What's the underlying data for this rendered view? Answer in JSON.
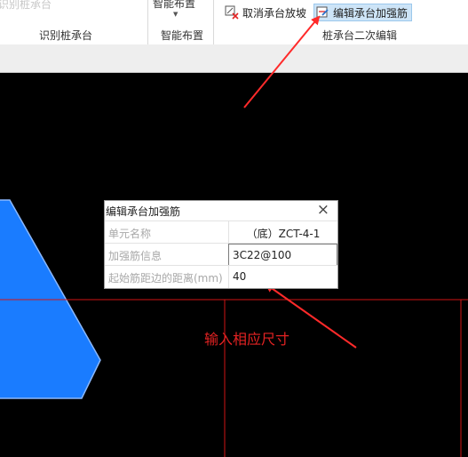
{
  "ribbon": {
    "faded_item": "识别桩承台",
    "groups": {
      "identify_label": "识别桩承台",
      "smart_top": "智能布置",
      "smart_label": "智能布置",
      "secondary_label": "桩承台二次编辑"
    },
    "buttons": {
      "cancel_slope": "取消承台放坡",
      "edit_rebar": "编辑承台加强筋"
    }
  },
  "dialog": {
    "title": "编辑承台加强筋",
    "rows": [
      {
        "label": "单元名称",
        "value": "（底）ZCT-4-1"
      },
      {
        "label": "加强筋信息",
        "value": "3C22@100"
      },
      {
        "label": "起始筋距边的距离(mm)",
        "value": "40"
      }
    ]
  },
  "annotation": {
    "text": "输入相应尺寸",
    "color": "#e22222"
  },
  "colors": {
    "canvas": "#000000",
    "shape_fill": "#1a7cff",
    "grid_line": "#d11515",
    "highlight": "#cde4f7"
  }
}
